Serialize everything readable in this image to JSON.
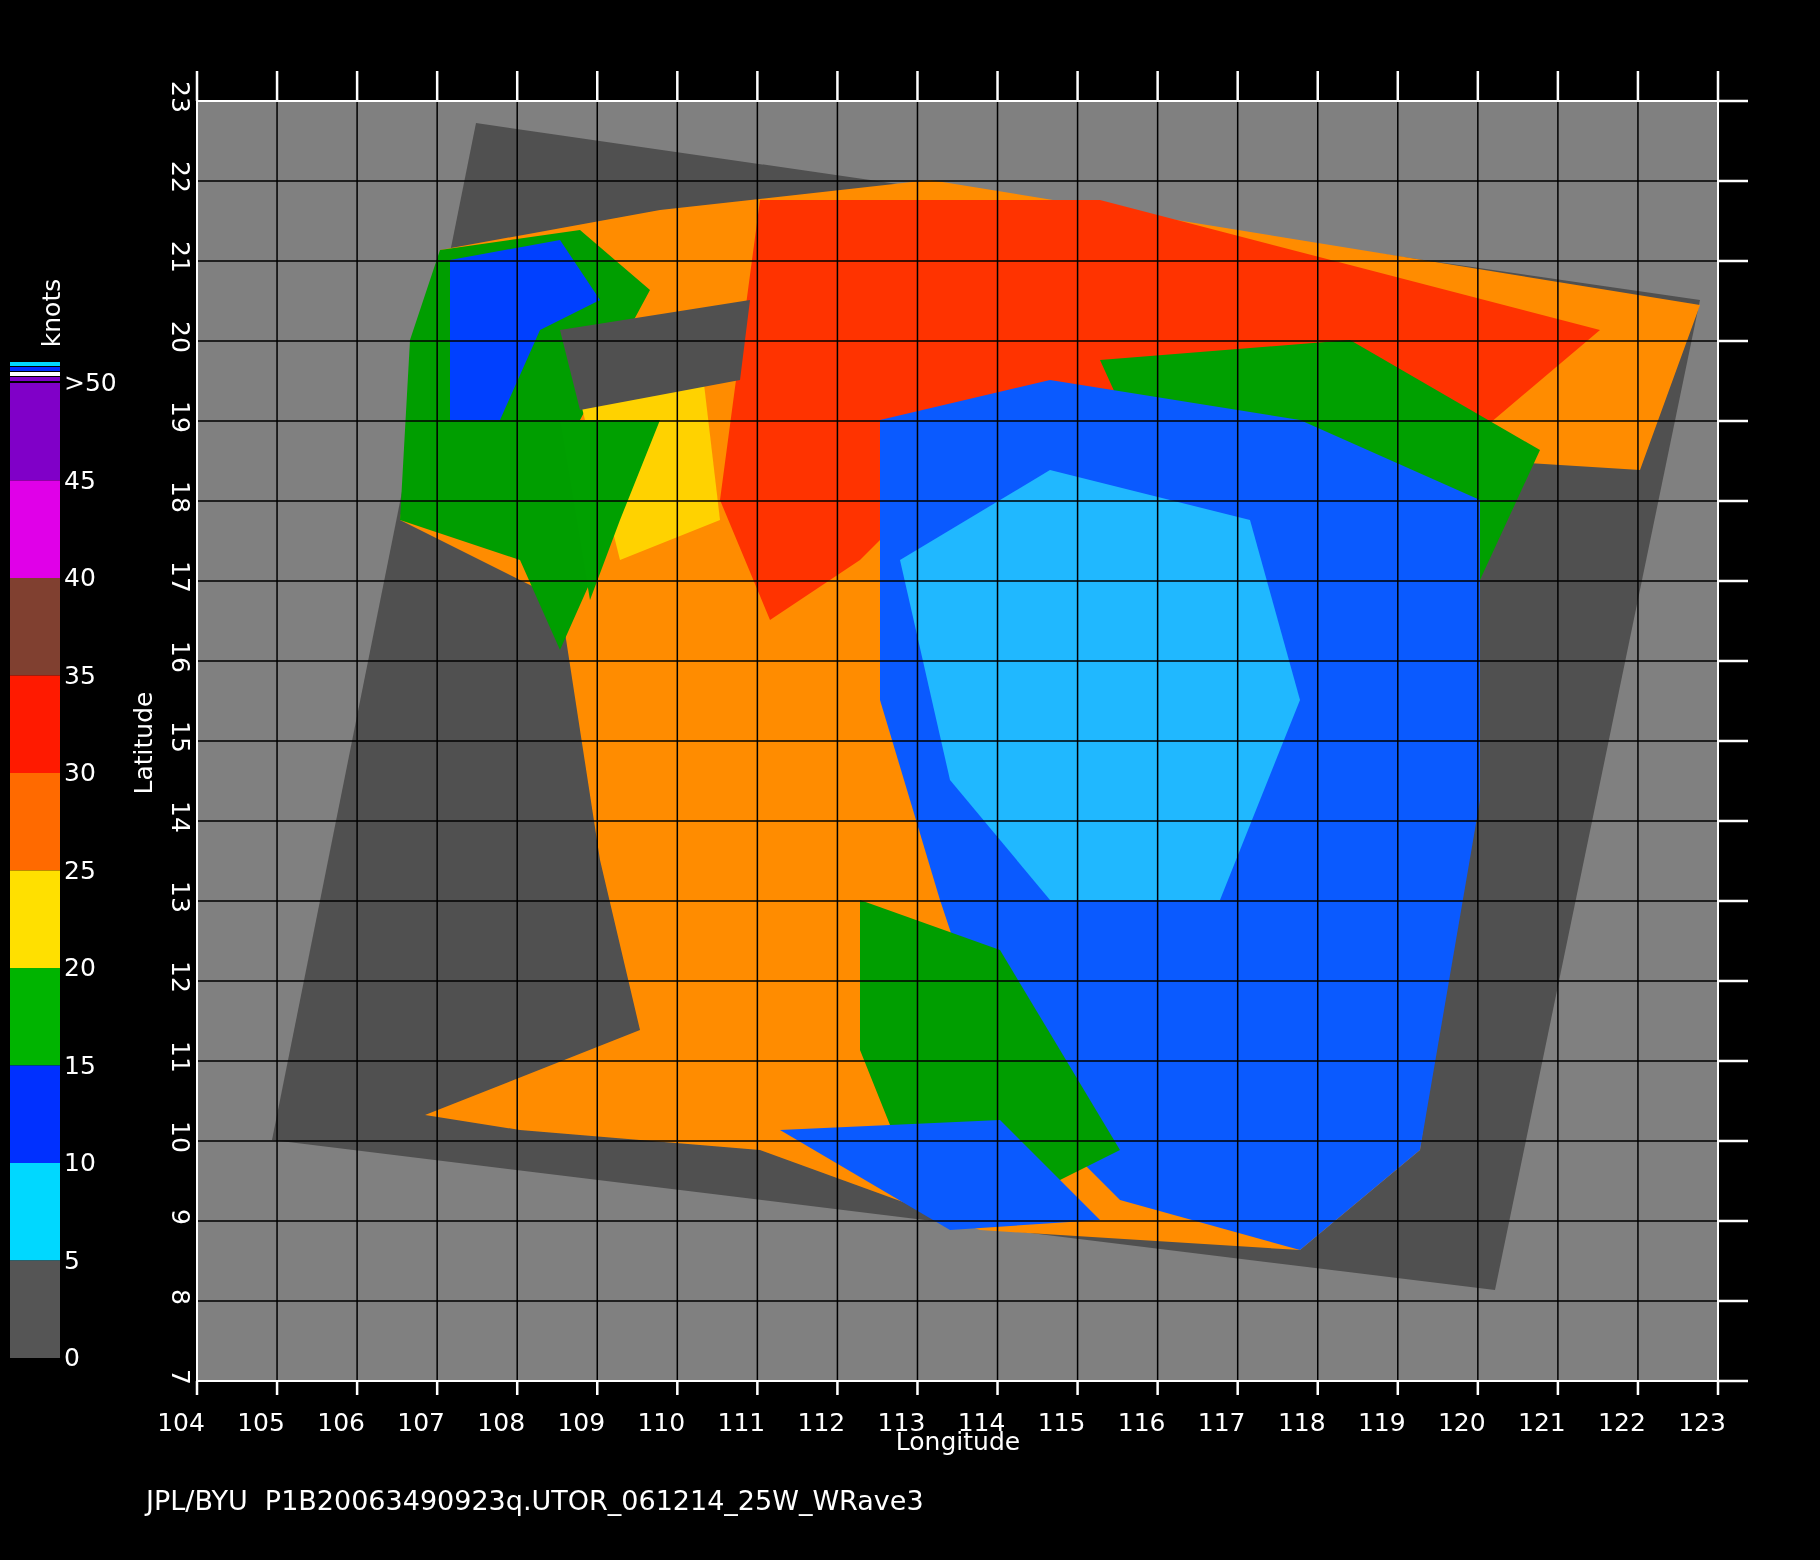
{
  "colorbar": {
    "unit": "knots",
    "ticks": [
      ">50",
      "45",
      "40",
      "35",
      "30",
      "25",
      "20",
      "15",
      "10",
      "5",
      "0"
    ],
    "segments": [
      {
        "color": "#8000c8"
      },
      {
        "color": "#e000e8"
      },
      {
        "color": "#804030"
      },
      {
        "color": "#ff1a00"
      },
      {
        "color": "#ff6a00"
      },
      {
        "color": "#ffe000"
      },
      {
        "color": "#00b400"
      },
      {
        "color": "#0030ff"
      },
      {
        "color": "#00d8ff"
      },
      {
        "color": "#555555"
      }
    ]
  },
  "y_axis": {
    "title": "Latitude",
    "ticks": [
      "7",
      "8",
      "9",
      "10",
      "11",
      "12",
      "13",
      "14",
      "15",
      "16",
      "17",
      "18",
      "19",
      "20",
      "21",
      "22",
      "23"
    ]
  },
  "x_axis": {
    "title": "Longitude",
    "ticks": [
      "104",
      "105",
      "106",
      "107",
      "108",
      "109",
      "110",
      "111",
      "112",
      "113",
      "114",
      "115",
      "116",
      "117",
      "118",
      "119",
      "120",
      "121",
      "122",
      "123"
    ]
  },
  "caption": "JPL/BYU  P1B20063490923q.UTOR_061214_25W_WRave3"
}
